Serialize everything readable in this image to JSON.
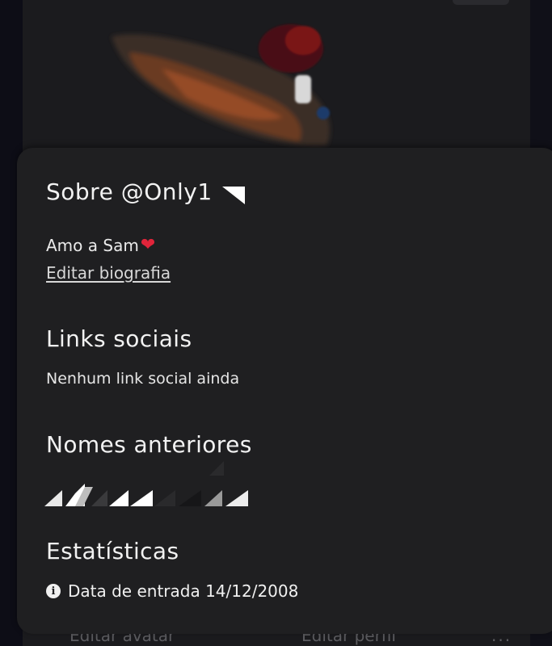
{
  "background": {
    "buttons": [
      "Editar avatar",
      "Editar perfil",
      "..."
    ]
  },
  "about": {
    "title": "Sobre @Only1",
    "bio_text": "Amo a Sam",
    "bio_emoji": "❤",
    "edit_bio_label": "Editar biografia"
  },
  "social_links": {
    "heading": "Links sociais",
    "empty_text": "Nenhum link social ainda"
  },
  "previous_names": {
    "heading": "Nomes anteriores"
  },
  "stats": {
    "heading": "Estatísticas",
    "joined_text": "Data de entrada 14/12/2008",
    "info_icon_glyph": "i"
  },
  "colors": {
    "sheet_bg": "#1f1f21",
    "heart": "#e0243a",
    "text": "#f2f2f2"
  }
}
